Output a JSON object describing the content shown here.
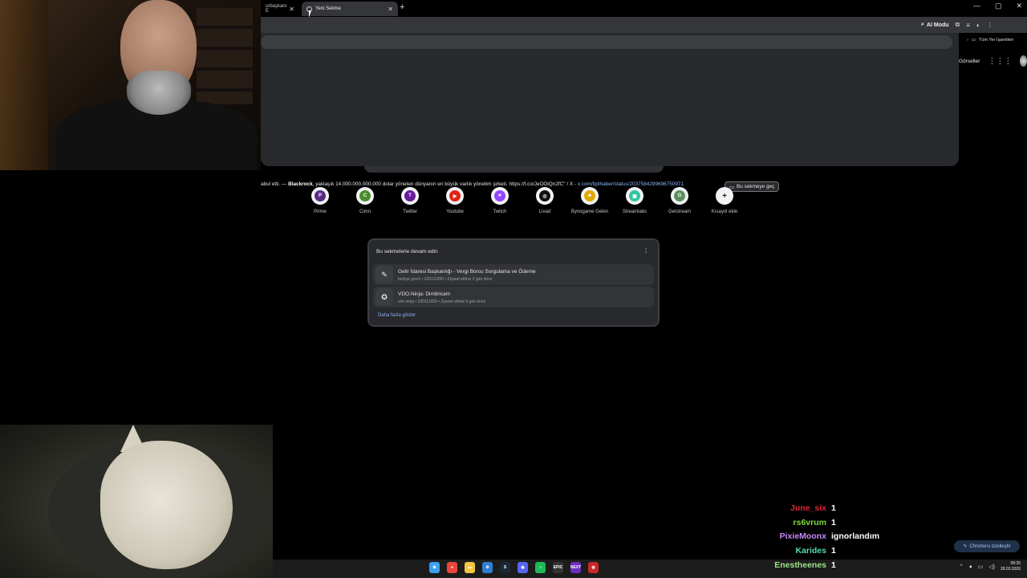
{
  "tabs": {
    "inactive_label": "urbaşkanı E",
    "active_label": "Yeni Sekme",
    "close_glyph": "✕",
    "new_tab_glyph": "+"
  },
  "window_controls": {
    "minimize": "—",
    "maximize": "▢",
    "close": "✕"
  },
  "toolbar": {
    "ai_mode_label": "AI Modu"
  },
  "bookmarks": {
    "all_bookmarks_label": "Tüm Yer İşaretleri",
    "chevron": "›"
  },
  "header": {
    "images_label": "Görseller"
  },
  "omnibox_suggestion": {
    "text_prefix": "abul etti. — ",
    "bold_word": "Blackrock",
    "text_main": ", yaklaşık 14.000.000.000.000 dolar yöneten dünyanın en büyük varlık yönetim şirketi. https://t.co/JeOOiQn2fC\" / X - ",
    "url": "x.com/bpthaber/status/2037584299696750971",
    "switch_tab_label": "Bu sekmeye geç"
  },
  "shortcuts": [
    {
      "label": "Prime",
      "letter": "P",
      "color": "#5b2b82"
    },
    {
      "label": "Cimri",
      "letter": "C",
      "color": "#4c8b2b"
    },
    {
      "label": "Twitter",
      "letter": "T",
      "color": "#6a1b9a"
    },
    {
      "label": "Youtube",
      "letter": "▶",
      "color": "#e62117"
    },
    {
      "label": "Twitch",
      "letter": "⌗",
      "color": "#9146ff"
    },
    {
      "label": "Livad",
      "letter": "◎",
      "color": "#111111"
    },
    {
      "label": "Bynogame Gelen",
      "letter": "☻",
      "color": "#e0a800"
    },
    {
      "label": "Streamlabs",
      "letter": "▣",
      "color": "#31c3a2"
    },
    {
      "label": "Getstream",
      "letter": "G",
      "color": "#5e8f5e"
    },
    {
      "label": "Kısayol ekle",
      "letter": "+",
      "color": "#f1f3f4"
    }
  ],
  "resume": {
    "title": "Bu sekmelerle devam edin",
    "menu_glyph": "⋮",
    "items": [
      {
        "title": "Gelir İdaresi Başkanlığı - Vergi Borcu Sorgulama ve Ödeme",
        "meta": "turkiye.gov.tr • 220111650 • Ziyaret ettiniz 2 gün önce",
        "icon": "✎"
      },
      {
        "title": "VDO.Ninja: Dimitricam",
        "meta": "vdo.ninja • 220111650 • Ziyaret ettiniz 6 gün önce",
        "icon": "✪"
      }
    ],
    "show_more": "Daha fazla göster"
  },
  "customize": {
    "label": "Chrome'u özelleştir",
    "icon": "✎"
  },
  "chat": [
    {
      "user": "June_six",
      "color": "#e0223a",
      "message": "1"
    },
    {
      "user": "rs6vrum",
      "color": "#7cdc3a",
      "message": "1"
    },
    {
      "user": "PixieMoonx",
      "color": "#c58af9",
      "message": "ignorlandım"
    },
    {
      "user": "Karides",
      "color": "#58d6b0",
      "message": "1"
    },
    {
      "user": "Enestheenes",
      "color": "#9be38a",
      "message": "1"
    }
  ],
  "taskbar": {
    "apps": [
      {
        "name": "start",
        "glyph": "⊞",
        "color": "#3aa0f0"
      },
      {
        "name": "chrome",
        "glyph": "●",
        "color": "#e8453c"
      },
      {
        "name": "explorer",
        "glyph": "▬",
        "color": "#f5c542"
      },
      {
        "name": "app-blue",
        "glyph": "⚙",
        "color": "#2d7fd3"
      },
      {
        "name": "steam",
        "glyph": "S",
        "color": "#1b2838"
      },
      {
        "name": "discord",
        "glyph": "◉",
        "color": "#5865f2"
      },
      {
        "name": "spotify",
        "glyph": "♫",
        "color": "#1db954"
      },
      {
        "name": "epic",
        "glyph": "EPIC",
        "color": "#333333"
      },
      {
        "name": "next",
        "glyph": "NEXT",
        "color": "#6b2fbf"
      },
      {
        "name": "app-red",
        "glyph": "◍",
        "color": "#c62828"
      }
    ],
    "time": "08:35",
    "date": "28.03.2026"
  }
}
